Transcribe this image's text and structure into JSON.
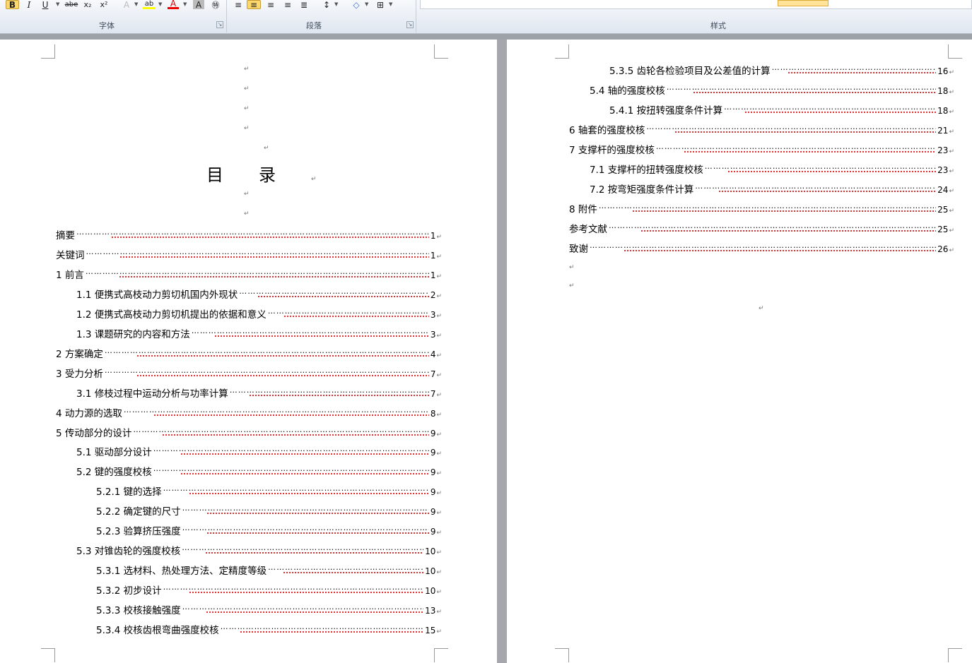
{
  "ribbon": {
    "groups": [
      {
        "label": "字体"
      },
      {
        "label": "段落"
      },
      {
        "label": "样式"
      }
    ],
    "font_buttons": [
      "B",
      "I",
      "U",
      "abe",
      "x₂",
      "x²",
      "A",
      "ab",
      "A",
      "A",
      "㊕"
    ],
    "paragraph_buttons": [
      "≡",
      "≡",
      "≡",
      "≡",
      "≣",
      "↕",
      "◇",
      "⊞"
    ]
  },
  "paragraph_mark": "↵",
  "left_page": {
    "blank_marks": 7,
    "title": "目录",
    "entries": [
      {
        "label": "摘要",
        "page": "1",
        "level": 0
      },
      {
        "label": "关键词",
        "page": "1",
        "level": 0
      },
      {
        "label": "1 前言",
        "page": "1",
        "level": 0
      },
      {
        "label": "1.1 便携式高枝动力剪切机国内外现状",
        "page": "2",
        "level": 1
      },
      {
        "label": "1.2 便携式高枝动力剪切机提出的依据和意义",
        "page": "3",
        "level": 1
      },
      {
        "label": "1.3 课题研究的内容和方法",
        "page": "3",
        "level": 1
      },
      {
        "label": "2 方案确定",
        "page": "4",
        "level": 0
      },
      {
        "label": "3 受力分析",
        "page": "7",
        "level": 0
      },
      {
        "label": "3.1 修枝过程中运动分析与功率计算",
        "page": "7",
        "level": 1
      },
      {
        "label": "4 动力源的选取",
        "page": "8",
        "level": 0
      },
      {
        "label": "5 传动部分的设计",
        "page": "9",
        "level": 0
      },
      {
        "label": "5.1 驱动部分设计",
        "page": "9",
        "level": 1
      },
      {
        "label": "5.2 键的强度校核",
        "page": "9",
        "level": 1
      },
      {
        "label": "5.2.1 键的选择",
        "page": "9",
        "level": 2
      },
      {
        "label": "5.2.2 确定键的尺寸",
        "page": "9",
        "level": 2
      },
      {
        "label": "5.2.3 验算挤压强度",
        "page": "9",
        "level": 2
      },
      {
        "label": "5.3 对锥齿轮的强度校核",
        "page": "10",
        "level": 1
      },
      {
        "label": "5.3.1 选材料、热处理方法、定精度等级",
        "page": "10",
        "level": 2
      },
      {
        "label": "5.3.2 初步设计",
        "page": "10",
        "level": 2
      },
      {
        "label": "5.3.3 校核接触强度",
        "page": "13",
        "level": 2
      },
      {
        "label": "5.3.4 校核齿根弯曲强度校核",
        "page": "15",
        "level": 2
      }
    ]
  },
  "right_page": {
    "entries": [
      {
        "label": "5.3.5 齿轮各检验项目及公差值的计算",
        "page": "16",
        "level": 2
      },
      {
        "label": "5.4 轴的强度校核",
        "page": "18",
        "level": 1
      },
      {
        "label": "5.4.1 按扭转强度条件计算",
        "page": "18",
        "level": 2
      },
      {
        "label": "6 轴套的强度校核",
        "page": "21",
        "level": 0
      },
      {
        "label": "7 支撑杆的强度校核",
        "page": "23",
        "level": 0
      },
      {
        "label": "7.1 支撑杆的扭转强度校核",
        "page": "23",
        "level": 1
      },
      {
        "label": "7.2 按弯矩强度条件计算",
        "page": "24",
        "level": 1
      },
      {
        "label": "8 附件",
        "page": "25",
        "level": 0
      },
      {
        "label": "参考文献",
        "page": "25",
        "level": 0
      },
      {
        "label": "致谢",
        "page": "26",
        "level": 0
      }
    ]
  }
}
